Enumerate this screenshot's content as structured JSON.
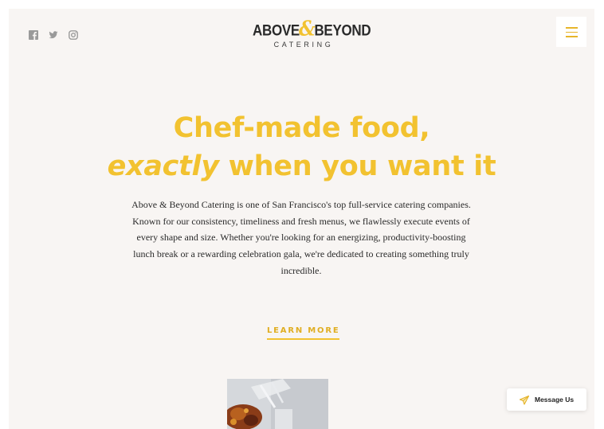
{
  "social": {
    "icons": [
      "facebook-icon",
      "twitter-icon",
      "instagram-icon"
    ]
  },
  "logo": {
    "part1": "ABOVE",
    "amp": "&",
    "part2": "BEYOND",
    "sub": "CATERING"
  },
  "menu": {
    "icon": "hamburger-icon"
  },
  "hero": {
    "line1": "Chef-made food,",
    "line2_em": "exactly",
    "line2_rest": " when you want it",
    "paragraph": "Above & Beyond Catering is one of San Francisco's top full-service catering companies. Known for our consistency, timeliness and fresh menus, we flawlessly execute events of every shape and size. Whether you're looking for an energizing, productivity-boosting lunch break or a rewarding celebration gala, we're dedicated to creating something truly incredible.",
    "cta": "LEARN MORE"
  },
  "chat": {
    "label": "Message Us",
    "icon": "paper-plane-icon"
  },
  "colors": {
    "accent": "#f2c230",
    "background": "#f8f5f3",
    "text": "#2a2a2a"
  }
}
